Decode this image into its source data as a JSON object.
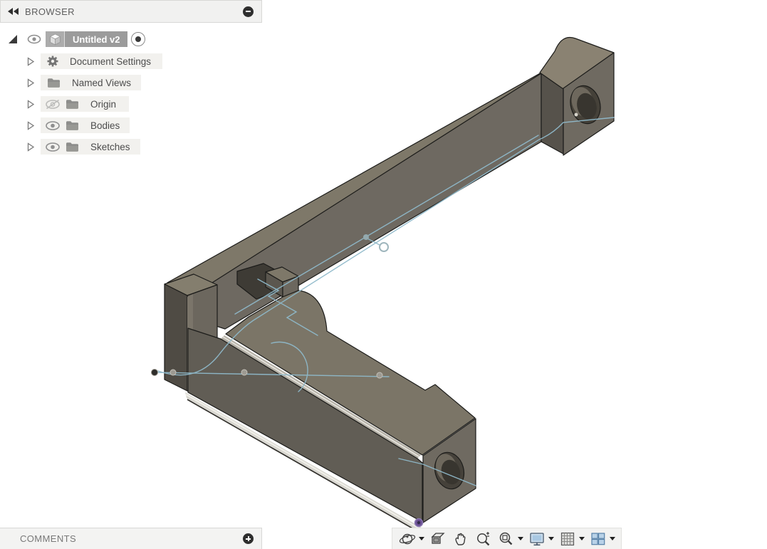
{
  "browser": {
    "title": "BROWSER",
    "collapse_icon": "double-left-arrows",
    "minimize_icon": "minus-circle",
    "root": {
      "label": "Untitled v2",
      "selected": true,
      "icons": [
        "eye-visible",
        "component-cube",
        "activate-radio"
      ]
    },
    "items": [
      {
        "label": "Document Settings",
        "icon": "gear",
        "visibility": null
      },
      {
        "label": "Named Views",
        "icon": "folder",
        "visibility": null
      },
      {
        "label": "Origin",
        "icon": "folder",
        "visibility": "hidden"
      },
      {
        "label": "Bodies",
        "icon": "folder",
        "visibility": "visible"
      },
      {
        "label": "Sketches",
        "icon": "folder",
        "visibility": "visible"
      }
    ]
  },
  "comments": {
    "title": "COMMENTS",
    "add_icon": "plus-circle"
  },
  "navbar": {
    "tools": [
      {
        "name": "orbit",
        "has_dropdown": true
      },
      {
        "name": "look-at",
        "has_dropdown": false
      },
      {
        "name": "pan",
        "has_dropdown": false
      },
      {
        "name": "zoom",
        "has_dropdown": false
      },
      {
        "name": "fit",
        "has_dropdown": true
      },
      {
        "name": "display-settings",
        "has_dropdown": true
      },
      {
        "name": "grid-and-snaps",
        "has_dropdown": true
      },
      {
        "name": "viewports",
        "has_dropdown": true
      }
    ]
  },
  "viewport": {
    "content": "L-shaped corner bracket solid with cylindrical holes in both end blocks and an active sketch",
    "colors": {
      "background": "#ffffff",
      "body_top_face": "#7e7869",
      "body_front_face": "#6e6961",
      "body_dark_face": "#54504a",
      "edge_line": "#1c1c1a",
      "chamfer_highlight": "#eeede7",
      "sketch_line": "#8fb9ca",
      "sketch_point_gray": "#9d9a92",
      "origin_point": "#2f2e2b",
      "locked_point_purple": "#6b5094"
    }
  }
}
